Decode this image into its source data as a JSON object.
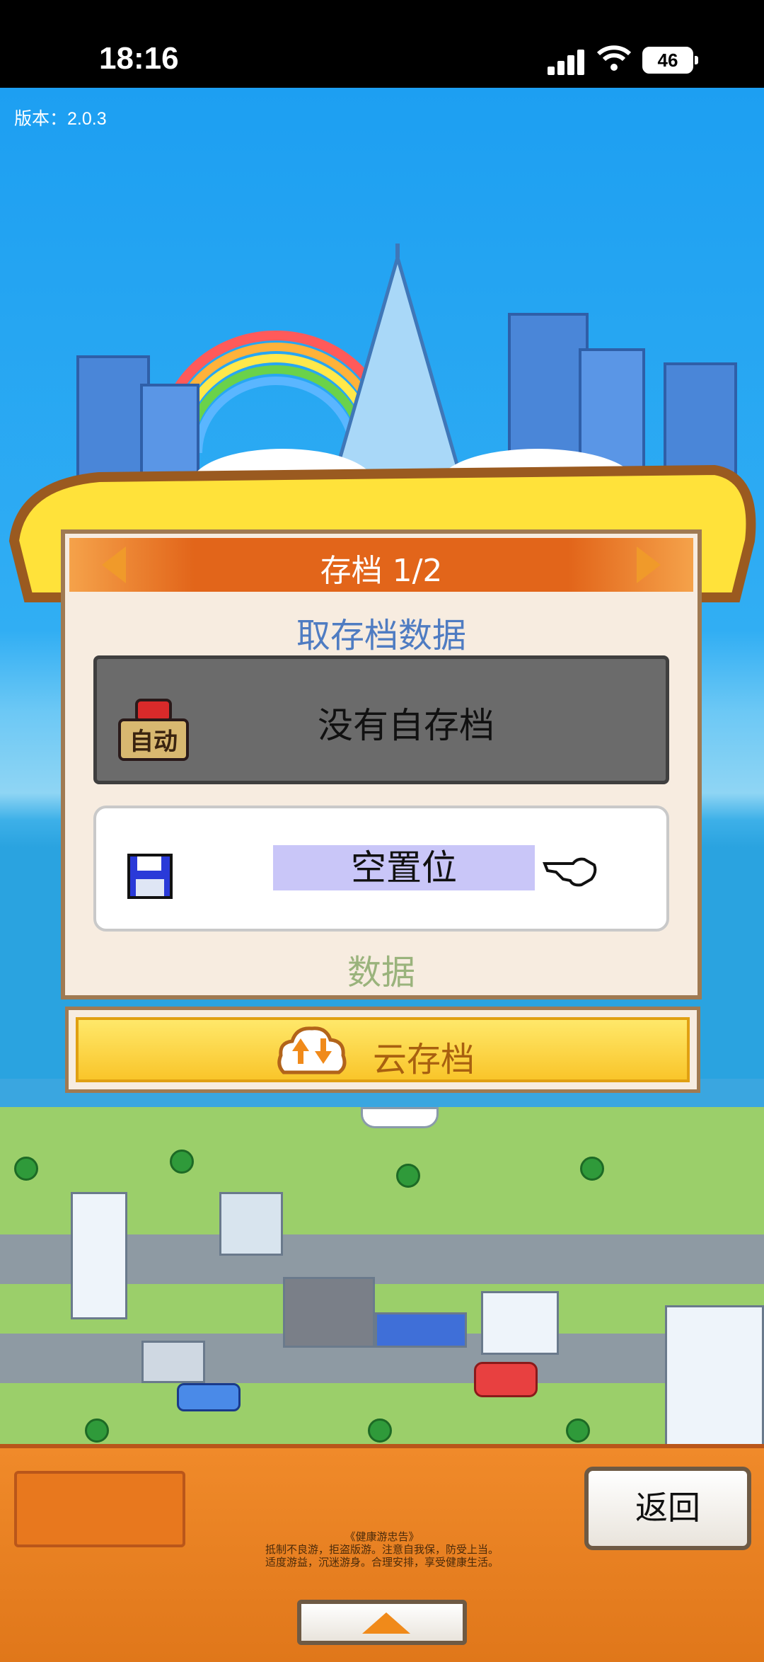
{
  "status_bar": {
    "time": "18:16",
    "battery": "46"
  },
  "version_label": "版本：2.0.3",
  "dialog": {
    "title": "存档 1/2",
    "subtitle": "取存档数据",
    "auto_slot": {
      "icon_text": "自动",
      "label": "没有自存档"
    },
    "empty_slot": {
      "label": "空置位"
    },
    "data_label": "数据"
  },
  "cloud_button": {
    "label": "云存档"
  },
  "bottom_bar": {
    "back_label": "返回",
    "notice_title": "《健康游忠告》",
    "notice_line1": "抵制不良游，拒盗版游。注意自我保，防受上当。",
    "notice_line2": "适度游益，沉迷游身。合理安排，享受健康生活。"
  },
  "colors": {
    "sky": "#1ea0f0",
    "dialog_header": "#e2651a",
    "accent_blue": "#4f7cc2",
    "cloud_button": "#f9c52a"
  }
}
